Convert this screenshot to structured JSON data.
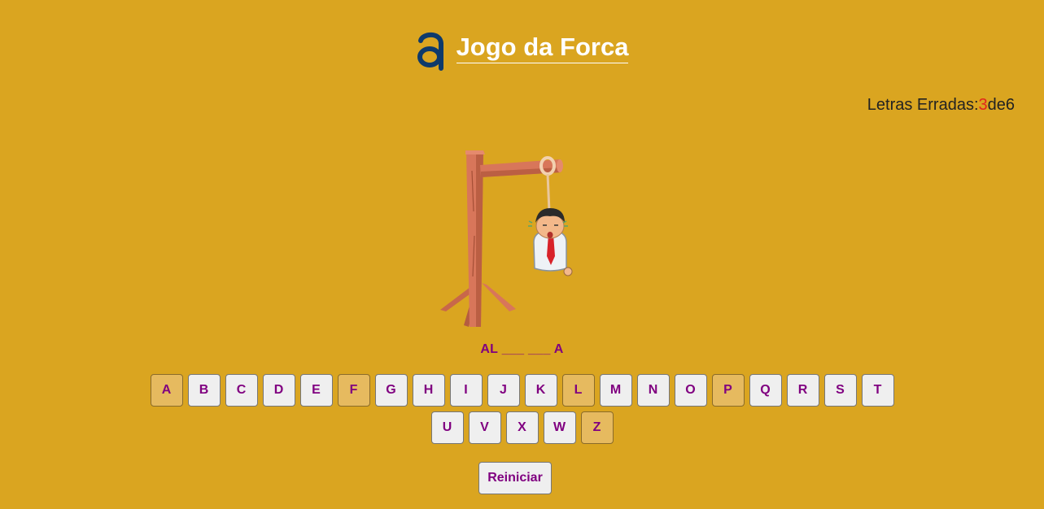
{
  "header": {
    "logo_icon": "a-logo-icon",
    "title": "Jogo da Forca"
  },
  "status": {
    "label": "Letras Erradas:",
    "wrong": "3",
    "separator": "de",
    "max": "6"
  },
  "word": {
    "display": "AL ___ ___ A"
  },
  "keyboard": {
    "rows": [
      [
        "A",
        "B",
        "C",
        "D",
        "E",
        "F",
        "G",
        "H",
        "I",
        "J",
        "K",
        "L",
        "M",
        "N",
        "O",
        "P",
        "Q",
        "R",
        "S",
        "T"
      ],
      [
        "U",
        "V",
        "X",
        "W",
        "Z"
      ]
    ],
    "used": [
      "A",
      "F",
      "L",
      "P",
      "Z"
    ]
  },
  "actions": {
    "restart_label": "Reiniciar"
  },
  "colors": {
    "background": "#DAA520",
    "letter": "#800080",
    "wrong_count": "#e3261c",
    "logo": "#0e3a6b"
  }
}
